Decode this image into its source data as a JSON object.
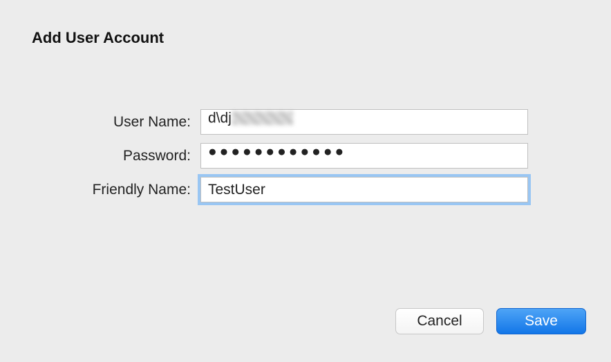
{
  "dialog": {
    "title": "Add User Account"
  },
  "form": {
    "username": {
      "label": "User Name:",
      "visible_prefix": "d\\dj"
    },
    "password": {
      "label": "Password:",
      "mask": "●●●●●●●●●●●●"
    },
    "friendly_name": {
      "label": "Friendly Name:",
      "value": "TestUser"
    }
  },
  "buttons": {
    "cancel": "Cancel",
    "save": "Save"
  },
  "colors": {
    "background": "#ececec",
    "focus_ring": "#99c6f3",
    "primary_button": "#1276e8"
  }
}
